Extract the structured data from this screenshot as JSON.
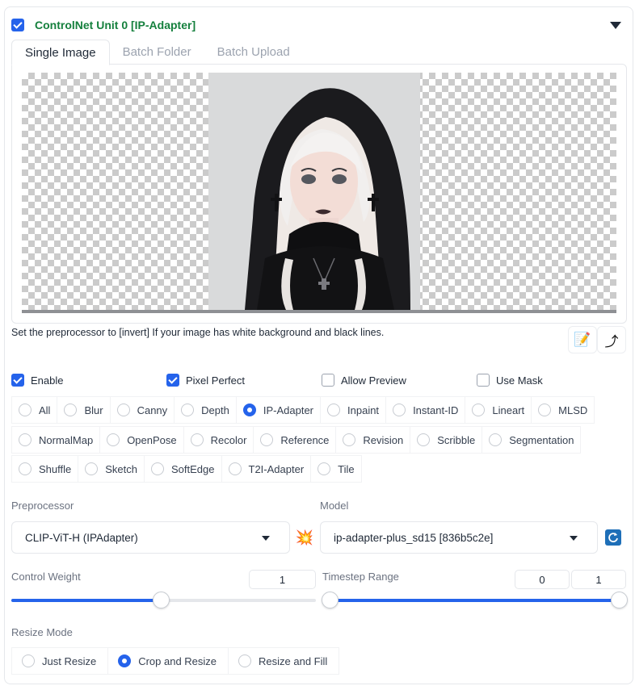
{
  "unit": {
    "title": "ControlNet Unit 0 [IP-Adapter]",
    "enabled": true
  },
  "tabs": [
    "Single Image",
    "Batch Folder",
    "Batch Upload"
  ],
  "note": "Set the preprocessor to [invert] If your image has white background and black lines.",
  "options": {
    "enable": {
      "label": "Enable",
      "checked": true
    },
    "pixel_perfect": {
      "label": "Pixel Perfect",
      "checked": true
    },
    "allow_preview": {
      "label": "Allow Preview",
      "checked": false
    },
    "use_mask": {
      "label": "Use Mask",
      "checked": false
    }
  },
  "control_types": {
    "row1": [
      "All",
      "Blur",
      "Canny",
      "Depth",
      "IP-Adapter",
      "Inpaint",
      "Instant-ID",
      "Lineart",
      "MLSD"
    ],
    "row2": [
      "NormalMap",
      "OpenPose",
      "Recolor",
      "Reference",
      "Revision",
      "Scribble",
      "Segmentation"
    ],
    "row3": [
      "Shuffle",
      "Sketch",
      "SoftEdge",
      "T2I-Adapter",
      "Tile"
    ],
    "selected": "IP-Adapter"
  },
  "preprocessor": {
    "label": "Preprocessor",
    "value": "CLIP-ViT-H (IPAdapter)"
  },
  "model": {
    "label": "Model",
    "value": "ip-adapter-plus_sd15 [836b5c2e]"
  },
  "control_weight": {
    "label": "Control Weight",
    "value": "1",
    "fraction": 0.49
  },
  "timestep_range": {
    "label": "Timestep Range",
    "start": "0",
    "end": "1",
    "start_fraction": 0,
    "end_fraction": 1
  },
  "resize_mode": {
    "label": "Resize Mode",
    "options": [
      "Just Resize",
      "Crop and Resize",
      "Resize and Fill"
    ],
    "selected": "Crop and Resize"
  },
  "colors": {
    "accent": "#2563eb",
    "title": "#15803d"
  }
}
